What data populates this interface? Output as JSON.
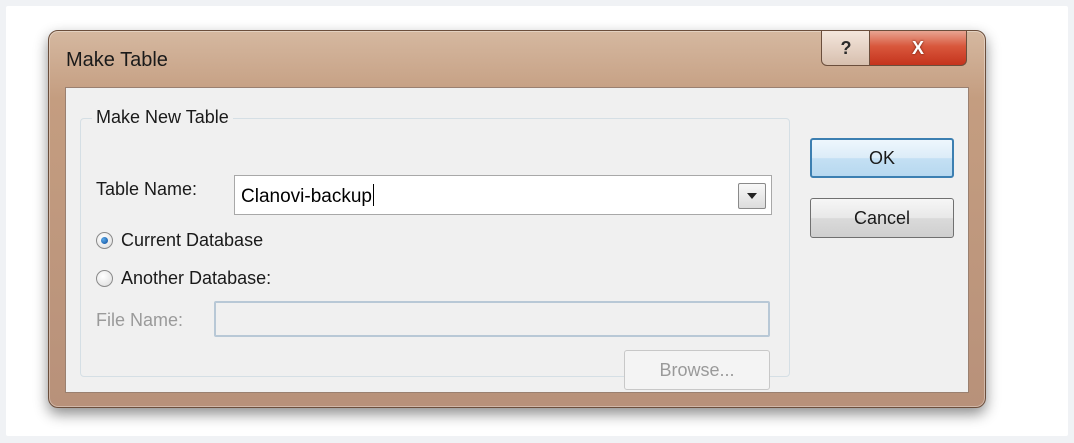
{
  "window": {
    "title": "Make Table",
    "help_glyph": "?",
    "close_glyph": "X"
  },
  "group": {
    "label": "Make New Table"
  },
  "table_name": {
    "label": "Table Name:",
    "value": "Clanovi-backup"
  },
  "radios": {
    "current_database": {
      "label": "Current Database",
      "checked": true
    },
    "another_database": {
      "label": "Another Database:",
      "checked": false
    }
  },
  "file_name": {
    "label": "File Name:",
    "value": ""
  },
  "buttons": {
    "browse": "Browse...",
    "ok": "OK",
    "cancel": "Cancel"
  },
  "colors": {
    "titlebar": "#c49d80",
    "close_button": "#d8573c",
    "ok_border": "#3c7fb1",
    "disabled_text": "#9a9a9a"
  }
}
